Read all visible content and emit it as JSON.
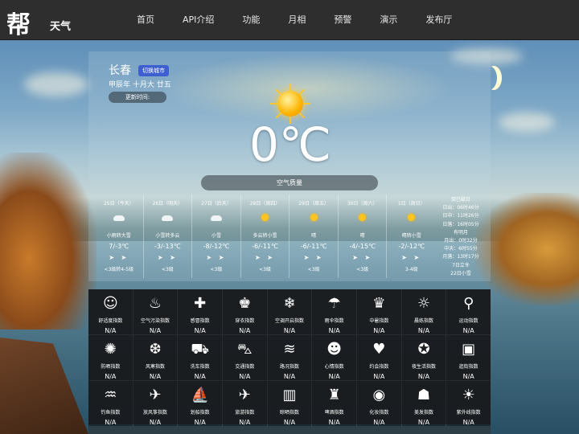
{
  "header": {
    "logo_mark": "帮",
    "logo_text": "天气",
    "nav": [
      "首页",
      "API介绍",
      "功能",
      "月相",
      "预警",
      "演示",
      "发布厅"
    ]
  },
  "weather": {
    "city": "长春",
    "switch_city": "切换城市",
    "lunar_date": "甲辰年 十月大 廿五",
    "update_label": "更新时间:",
    "temperature": "0℃",
    "air_quality_label": "空气质量"
  },
  "forecast": [
    {
      "title": "25日（今天）",
      "icon": "cloud",
      "desc": "小雨转大雪",
      "temp": "7/-3℃",
      "wind": "➤ ➤",
      "level": "<3级转4-5级"
    },
    {
      "title": "26日（明天）",
      "icon": "cloud",
      "desc": "小雪转多云",
      "temp": "-3/-13℃",
      "wind": "➤ ➤",
      "level": "<3级"
    },
    {
      "title": "27日（后天）",
      "icon": "cloud",
      "desc": "小雪",
      "temp": "-8/-12℃",
      "wind": "➤ ➤",
      "level": "<3级"
    },
    {
      "title": "28日（周四）",
      "icon": "sun",
      "desc": "多云转小雪",
      "temp": "-6/-11℃",
      "wind": "➤ ➤",
      "level": "<3级"
    },
    {
      "title": "29日（周五）",
      "icon": "sun",
      "desc": "晴",
      "temp": "-6/-11℃",
      "wind": "➤ ➤",
      "level": "<3级"
    },
    {
      "title": "30日（周六）",
      "icon": "sun",
      "desc": "晴",
      "temp": "-4/-15℃",
      "wind": "➤ ➤",
      "level": "<3级"
    },
    {
      "title": "1日（周日）",
      "icon": "sun",
      "desc": "晴转小雪",
      "temp": "-2/-12℃",
      "wind": "➤ ➤",
      "level": "3-4级"
    }
  ],
  "almanac": [
    "癸巳破日",
    "日出：06时46分",
    "日中：11时26分",
    "日落：16时05分",
    "有明月",
    "月出：0时32分",
    "中天：6时55分",
    "月落：13时17分",
    "7日立冬",
    "22日小雪"
  ],
  "indices": [
    {
      "icon": "☺",
      "name": "舒适度指数",
      "value": "N/A"
    },
    {
      "icon": "♨",
      "name": "空气污染指数",
      "value": "N/A"
    },
    {
      "icon": "✚",
      "name": "感冒指数",
      "value": "N/A"
    },
    {
      "icon": "♚",
      "name": "穿衣指数",
      "value": "N/A"
    },
    {
      "icon": "❄",
      "name": "空调开启指数",
      "value": "N/A"
    },
    {
      "icon": "☂",
      "name": "雨伞指数",
      "value": "N/A"
    },
    {
      "icon": "♛",
      "name": "中暑指数",
      "value": "N/A"
    },
    {
      "icon": "☼",
      "name": "晨练指数",
      "value": "N/A"
    },
    {
      "icon": "⚲",
      "name": "运动指数",
      "value": "N/A"
    },
    {
      "icon": "✺",
      "name": "防晒指数",
      "value": "N/A"
    },
    {
      "icon": "❆",
      "name": "风寒指数",
      "value": "N/A"
    },
    {
      "icon": "⛟",
      "name": "洗车指数",
      "value": "N/A"
    },
    {
      "icon": "⛍",
      "name": "交通指数",
      "value": "N/A"
    },
    {
      "icon": "≋",
      "name": "路况指数",
      "value": "N/A"
    },
    {
      "icon": "☻",
      "name": "心情指数",
      "value": "N/A"
    },
    {
      "icon": "♥",
      "name": "约会指数",
      "value": "N/A"
    },
    {
      "icon": "✪",
      "name": "夜生活指数",
      "value": "N/A"
    },
    {
      "icon": "▣",
      "name": "逛街指数",
      "value": "N/A"
    },
    {
      "icon": "♒",
      "name": "钓鱼指数",
      "value": "N/A"
    },
    {
      "icon": "✈",
      "name": "放风筝指数",
      "value": "N/A"
    },
    {
      "icon": "⛵",
      "name": "划船指数",
      "value": "N/A"
    },
    {
      "icon": "✈",
      "name": "旅游指数",
      "value": "N/A"
    },
    {
      "icon": "▥",
      "name": "晾晒指数",
      "value": "N/A"
    },
    {
      "icon": "♜",
      "name": "啤酒指数",
      "value": "N/A"
    },
    {
      "icon": "◉",
      "name": "化妆指数",
      "value": "N/A"
    },
    {
      "icon": "☗",
      "name": "美发指数",
      "value": "N/A"
    },
    {
      "icon": "☀",
      "name": "紫外线指数",
      "value": "N/A"
    }
  ]
}
